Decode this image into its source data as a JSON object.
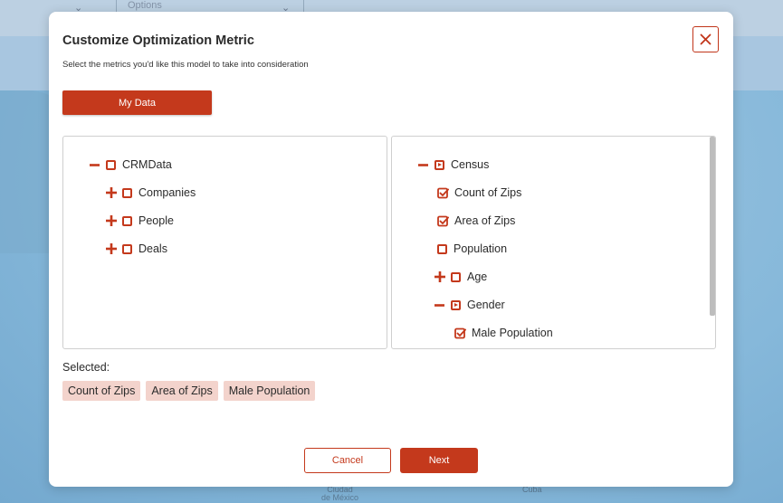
{
  "background": {
    "dropdown_partial": "",
    "dropdown_options": "Options",
    "map_labels": {
      "city_line1": "Ciudad",
      "city_line2": "de México",
      "cuba": "Cuba"
    }
  },
  "modal": {
    "title": "Customize Optimization Metric",
    "subtitle": "Select the metrics you'd like this model to take into consideration",
    "close_icon": "close-icon",
    "my_data_label": "My Data",
    "accent_color": "#c4391c",
    "left_tree": {
      "root": "CRMData",
      "children": [
        "Companies",
        "People",
        "Deals"
      ]
    },
    "right_tree": {
      "root": "Census",
      "items": {
        "count_of_zips": "Count of Zips",
        "area_of_zips": "Area of Zips",
        "population": "Population",
        "age": "Age",
        "gender": "Gender",
        "male_population": "Male Population"
      }
    },
    "selected_label": "Selected:",
    "selected": [
      "Count of Zips",
      "Area of Zips",
      "Male Population"
    ],
    "cancel_label": "Cancel",
    "next_label": "Next"
  }
}
